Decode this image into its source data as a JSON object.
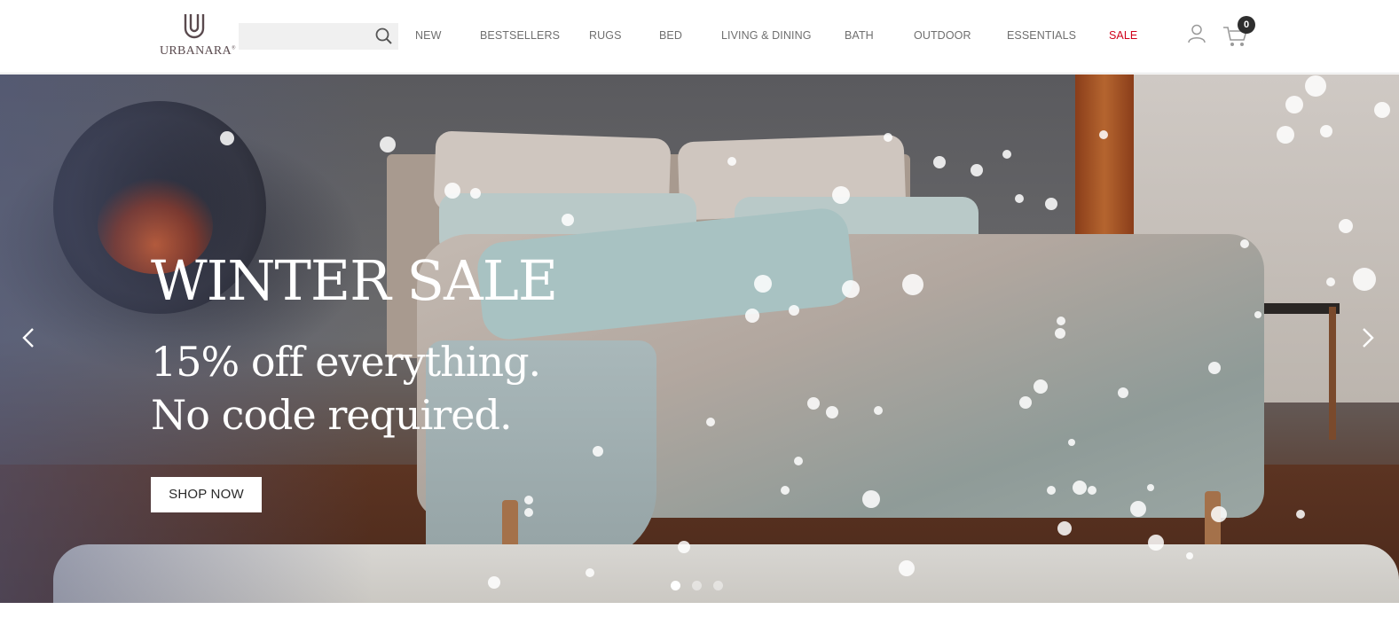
{
  "brand": {
    "name": "URBANARA",
    "trademark": "®"
  },
  "search": {
    "placeholder": "",
    "value": ""
  },
  "nav": {
    "items": [
      {
        "label": "NEW",
        "id": "new"
      },
      {
        "label": "BESTSELLERS",
        "id": "bestsellers"
      },
      {
        "label": "RUGS",
        "id": "rugs"
      },
      {
        "label": "BED",
        "id": "bed"
      },
      {
        "label": "LIVING & DINING",
        "id": "living-dining"
      },
      {
        "label": "BATH",
        "id": "bath"
      },
      {
        "label": "OUTDOOR",
        "id": "outdoor"
      },
      {
        "label": "ESSENTIALS",
        "id": "essentials"
      },
      {
        "label": "SALE",
        "id": "sale"
      }
    ],
    "sale_color": "#d0021b"
  },
  "cart": {
    "count": "0"
  },
  "hero": {
    "title": "WINTER SALE",
    "subtitle_line1": "15% off everything.",
    "subtitle_line2": "No code required.",
    "cta": "SHOP NOW",
    "slides": 3,
    "active_slide": 1
  },
  "icons": {
    "search": "search-icon",
    "account": "user-icon",
    "cart": "cart-icon",
    "prev": "chevron-left-icon",
    "next": "chevron-right-icon"
  }
}
